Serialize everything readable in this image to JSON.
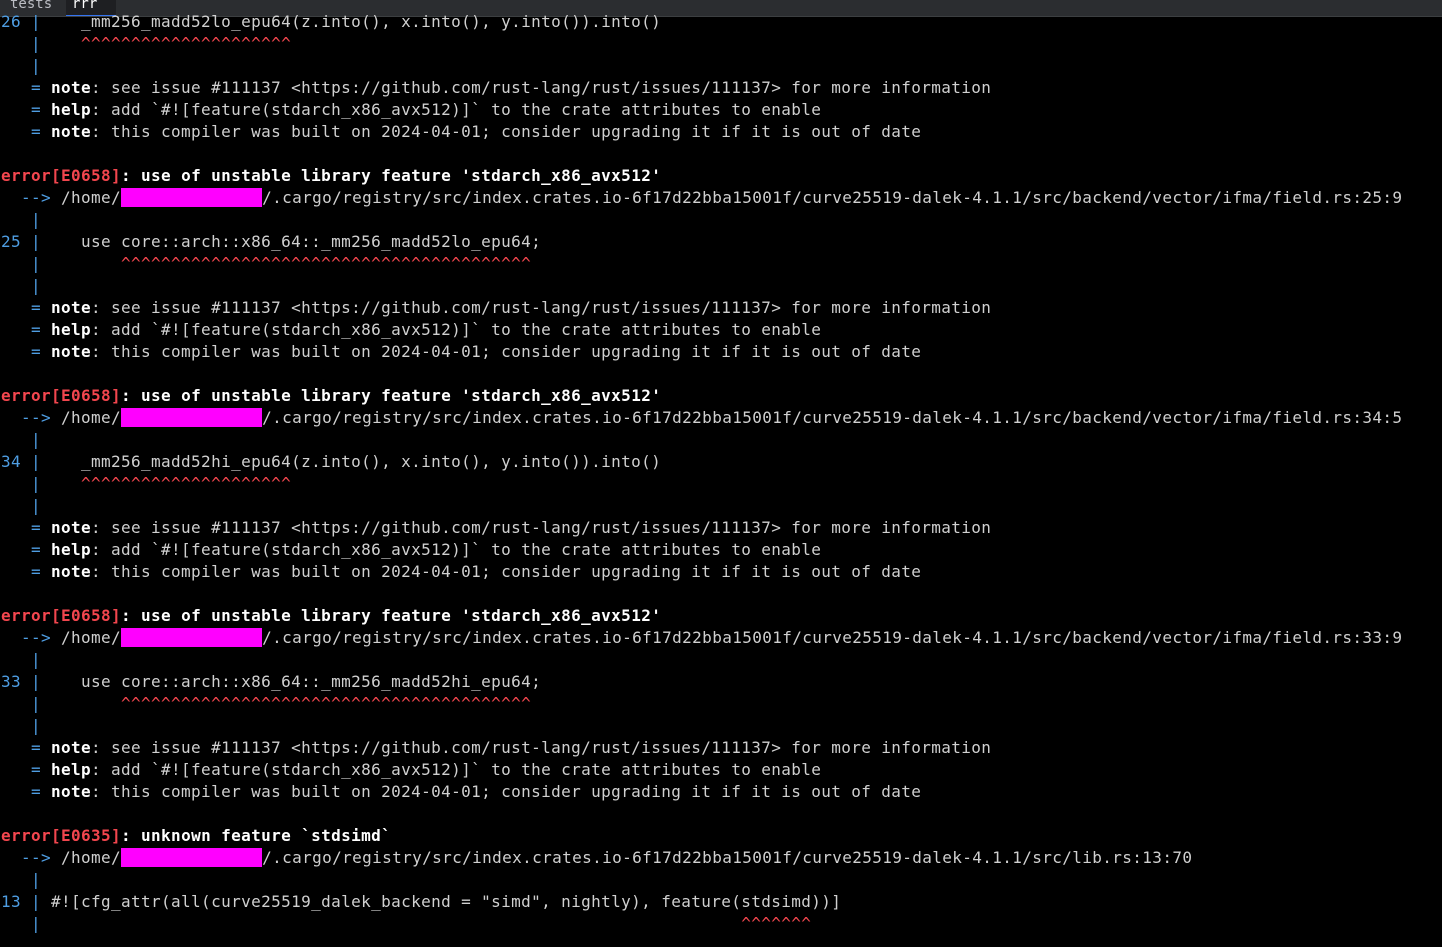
{
  "tabs": [
    "tests",
    "rrr"
  ],
  "palette": {
    "background": "#000000",
    "error_red": "#f2464e",
    "gutter_blue": "#4f9ee3",
    "redaction": "#ff00ff"
  },
  "lines": [
    {
      "kind": "code",
      "gutter": "26 |",
      "text": "    _mm256_madd52lo_epu64(z.into(), x.into(), y.into()).into()"
    },
    {
      "kind": "caret",
      "gutter": "   |",
      "text": "    ^^^^^^^^^^^^^^^^^^^^^"
    },
    {
      "kind": "pipe",
      "gutter": "   |"
    },
    {
      "kind": "note",
      "prefix": "   = ",
      "label": "note",
      "text": ": see issue #111137 <https://github.com/rust-lang/rust/issues/111137> for more information"
    },
    {
      "kind": "note",
      "prefix": "   = ",
      "label": "help",
      "text": ": add `#![feature(stdarch_x86_avx512)]` to the crate attributes to enable"
    },
    {
      "kind": "note",
      "prefix": "   = ",
      "label": "note",
      "text": ": this compiler was built on 2024-04-01; consider upgrading it if it is out of date"
    },
    {
      "kind": "blank"
    },
    {
      "kind": "error",
      "code": "error[E0658]",
      "text": ": use of unstable library feature 'stdarch_x86_avx512'"
    },
    {
      "kind": "arrow",
      "arrow": "  --> ",
      "pre": "/home/",
      "post": "/.cargo/registry/src/index.crates.io-6f17d22bba15001f/curve25519-dalek-4.1.1/src/backend/vector/ifma/field.rs:25:9"
    },
    {
      "kind": "pipe",
      "gutter": "   |"
    },
    {
      "kind": "code",
      "gutter": "25 |",
      "text": "    use core::arch::x86_64::_mm256_madd52lo_epu64;"
    },
    {
      "kind": "caret",
      "gutter": "   |",
      "text": "        ^^^^^^^^^^^^^^^^^^^^^^^^^^^^^^^^^^^^^^^^^"
    },
    {
      "kind": "pipe",
      "gutter": "   |"
    },
    {
      "kind": "note",
      "prefix": "   = ",
      "label": "note",
      "text": ": see issue #111137 <https://github.com/rust-lang/rust/issues/111137> for more information"
    },
    {
      "kind": "note",
      "prefix": "   = ",
      "label": "help",
      "text": ": add `#![feature(stdarch_x86_avx512)]` to the crate attributes to enable"
    },
    {
      "kind": "note",
      "prefix": "   = ",
      "label": "note",
      "text": ": this compiler was built on 2024-04-01; consider upgrading it if it is out of date"
    },
    {
      "kind": "blank"
    },
    {
      "kind": "error",
      "code": "error[E0658]",
      "text": ": use of unstable library feature 'stdarch_x86_avx512'"
    },
    {
      "kind": "arrow",
      "arrow": "  --> ",
      "pre": "/home/",
      "post": "/.cargo/registry/src/index.crates.io-6f17d22bba15001f/curve25519-dalek-4.1.1/src/backend/vector/ifma/field.rs:34:5"
    },
    {
      "kind": "pipe",
      "gutter": "   |"
    },
    {
      "kind": "code",
      "gutter": "34 |",
      "text": "    _mm256_madd52hi_epu64(z.into(), x.into(), y.into()).into()"
    },
    {
      "kind": "caret",
      "gutter": "   |",
      "text": "    ^^^^^^^^^^^^^^^^^^^^^"
    },
    {
      "kind": "pipe",
      "gutter": "   |"
    },
    {
      "kind": "note",
      "prefix": "   = ",
      "label": "note",
      "text": ": see issue #111137 <https://github.com/rust-lang/rust/issues/111137> for more information"
    },
    {
      "kind": "note",
      "prefix": "   = ",
      "label": "help",
      "text": ": add `#![feature(stdarch_x86_avx512)]` to the crate attributes to enable"
    },
    {
      "kind": "note",
      "prefix": "   = ",
      "label": "note",
      "text": ": this compiler was built on 2024-04-01; consider upgrading it if it is out of date"
    },
    {
      "kind": "blank"
    },
    {
      "kind": "error",
      "code": "error[E0658]",
      "text": ": use of unstable library feature 'stdarch_x86_avx512'"
    },
    {
      "kind": "arrow",
      "arrow": "  --> ",
      "pre": "/home/",
      "post": "/.cargo/registry/src/index.crates.io-6f17d22bba15001f/curve25519-dalek-4.1.1/src/backend/vector/ifma/field.rs:33:9"
    },
    {
      "kind": "pipe",
      "gutter": "   |"
    },
    {
      "kind": "code",
      "gutter": "33 |",
      "text": "    use core::arch::x86_64::_mm256_madd52hi_epu64;"
    },
    {
      "kind": "caret",
      "gutter": "   |",
      "text": "        ^^^^^^^^^^^^^^^^^^^^^^^^^^^^^^^^^^^^^^^^^"
    },
    {
      "kind": "pipe",
      "gutter": "   |"
    },
    {
      "kind": "note",
      "prefix": "   = ",
      "label": "note",
      "text": ": see issue #111137 <https://github.com/rust-lang/rust/issues/111137> for more information"
    },
    {
      "kind": "note",
      "prefix": "   = ",
      "label": "help",
      "text": ": add `#![feature(stdarch_x86_avx512)]` to the crate attributes to enable"
    },
    {
      "kind": "note",
      "prefix": "   = ",
      "label": "note",
      "text": ": this compiler was built on 2024-04-01; consider upgrading it if it is out of date"
    },
    {
      "kind": "blank"
    },
    {
      "kind": "error",
      "code": "error[E0635]",
      "text": ": unknown feature `stdsimd`"
    },
    {
      "kind": "arrow",
      "arrow": "  --> ",
      "pre": "/home/",
      "post": "/.cargo/registry/src/index.crates.io-6f17d22bba15001f/curve25519-dalek-4.1.1/src/lib.rs:13:70"
    },
    {
      "kind": "pipe",
      "gutter": "   |"
    },
    {
      "kind": "code",
      "gutter": "13 |",
      "text": " #![cfg_attr(all(curve25519_dalek_backend = \"simd\", nightly), feature(stdsimd))]"
    },
    {
      "kind": "caret",
      "gutter": "   |",
      "text": "                                                                      ^^^^^^^"
    }
  ]
}
